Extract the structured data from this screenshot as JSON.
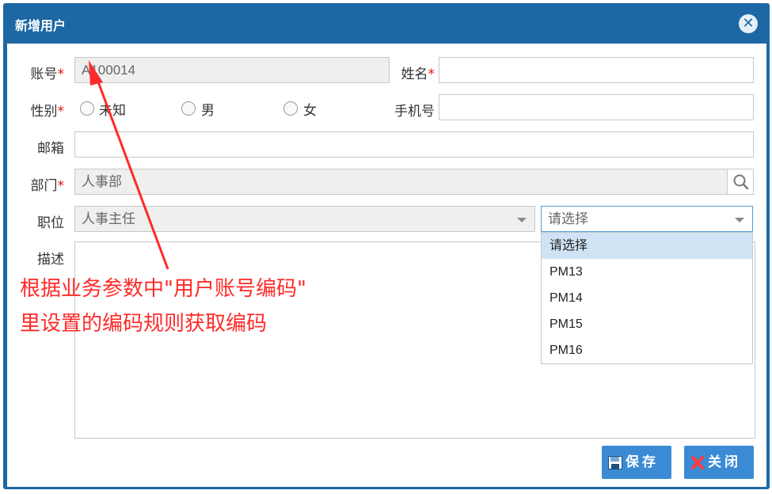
{
  "dialog": {
    "title": "新增用户",
    "close_glyph": "✕"
  },
  "form": {
    "account": {
      "label": "账号",
      "value": "A100014"
    },
    "name": {
      "label": "姓名",
      "value": ""
    },
    "gender": {
      "label": "性别",
      "options": [
        "未知",
        "男",
        "女"
      ]
    },
    "phone": {
      "label": "手机号",
      "value": ""
    },
    "email": {
      "label": "邮箱",
      "value": ""
    },
    "dept": {
      "label": "部门",
      "value": "人事部"
    },
    "position": {
      "label": "职位",
      "value": "人事主任"
    },
    "level": {
      "value": "请选择",
      "options": [
        "请选择",
        "PM13",
        "PM14",
        "PM15",
        "PM16"
      ]
    },
    "desc": {
      "label": "描述"
    },
    "required_mark": "*"
  },
  "buttons": {
    "save": "保存",
    "close": "关闭"
  },
  "annotation": {
    "line1": "根据业务参数中\"用户账号编码\"",
    "line2": "里设置的编码规则获取编码"
  },
  "colors": {
    "header": "#1d68a4",
    "button": "#3b8bd4",
    "annotation": "#ff2a2a",
    "selected": "#cfe3f4"
  },
  "icons": [
    "close-icon",
    "search-icon",
    "chevron-down-icon",
    "save-icon",
    "cancel-icon"
  ]
}
